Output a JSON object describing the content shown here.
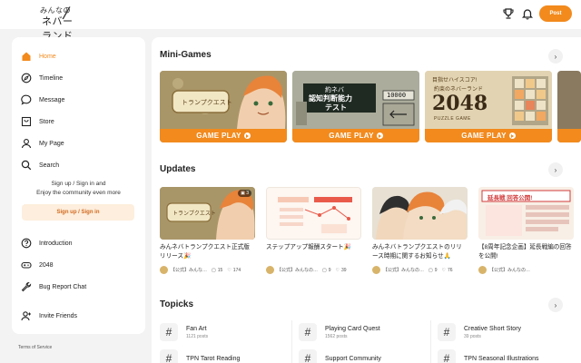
{
  "header": {
    "logo_line1": "みんなの",
    "logo_line2": "ネバーランド",
    "post_label": "Post"
  },
  "sidebar": {
    "items": [
      {
        "label": "Home",
        "icon": "home-icon",
        "active": true
      },
      {
        "label": "Timeline",
        "icon": "compass-icon"
      },
      {
        "label": "Message",
        "icon": "chat-icon"
      },
      {
        "label": "Store",
        "icon": "store-icon"
      },
      {
        "label": "My Page",
        "icon": "user-icon"
      },
      {
        "label": "Search",
        "icon": "search-icon"
      }
    ],
    "signup_text_1": "Sign up / Sign in and",
    "signup_text_2": "Enjoy the community even more",
    "signup_button": "Sign up / Sign in",
    "lower_items": [
      {
        "label": "Introduction",
        "icon": "question-icon"
      },
      {
        "label": "2048",
        "icon": "gamepad-icon"
      },
      {
        "label": "Bug Report Chat",
        "icon": "wrench-icon"
      }
    ],
    "invite_label": "Invite Friends",
    "terms": "Terms of Service"
  },
  "minigames": {
    "title": "Mini-Games",
    "cards": [
      {
        "play_label": "GAME PLAY",
        "art_text": "トランプクエスト"
      },
      {
        "play_label": "GAME PLAY",
        "art_text_1": "約ネバ",
        "art_text_2": "認知判断能力",
        "art_text_3": "テスト",
        "score": "10000"
      },
      {
        "play_label": "GAME PLAY",
        "art_text_1": "目指せハイスコア!",
        "art_text_2": "約束のネバーランド",
        "art_text_3": "2048",
        "art_text_4": "PUZZLE GAME"
      }
    ]
  },
  "updates": {
    "title": "Updates",
    "cards": [
      {
        "title": "みんネバトランプクエスト正式版リリース🎉",
        "author": "【公式】みんな…",
        "comments": "15",
        "likes": "174",
        "badge": "3"
      },
      {
        "title": "ステップアップ報酬スタート🎉",
        "author": "【公式】みんなの…",
        "comments": "9",
        "likes": "39"
      },
      {
        "title": "みんネバトランプクエストのリリース時期に関するお知らせ🙏",
        "author": "【公式】みんなの…",
        "comments": "9",
        "likes": "76"
      },
      {
        "title": "【8周年記念企画】延長戦編の回答を公開!",
        "author": "【公式】みんなの…",
        "comments": "",
        "likes": "",
        "banner": "延長戦 回答公開!"
      }
    ]
  },
  "topicks": {
    "title": "Topicks",
    "items": [
      {
        "name": "Fan Art",
        "count": "1121 posts"
      },
      {
        "name": "Playing Card Quest",
        "count": "1562 posts"
      },
      {
        "name": "Creative Short Story",
        "count": "39 posts"
      },
      {
        "name": "TPN Tarot Reading",
        "count": ""
      },
      {
        "name": "Support Community",
        "count": ""
      },
      {
        "name": "TPN Seasonal Illustrations",
        "count": ""
      }
    ]
  },
  "colors": {
    "accent": "#f28a1d",
    "accent_light": "#fdeedd"
  }
}
